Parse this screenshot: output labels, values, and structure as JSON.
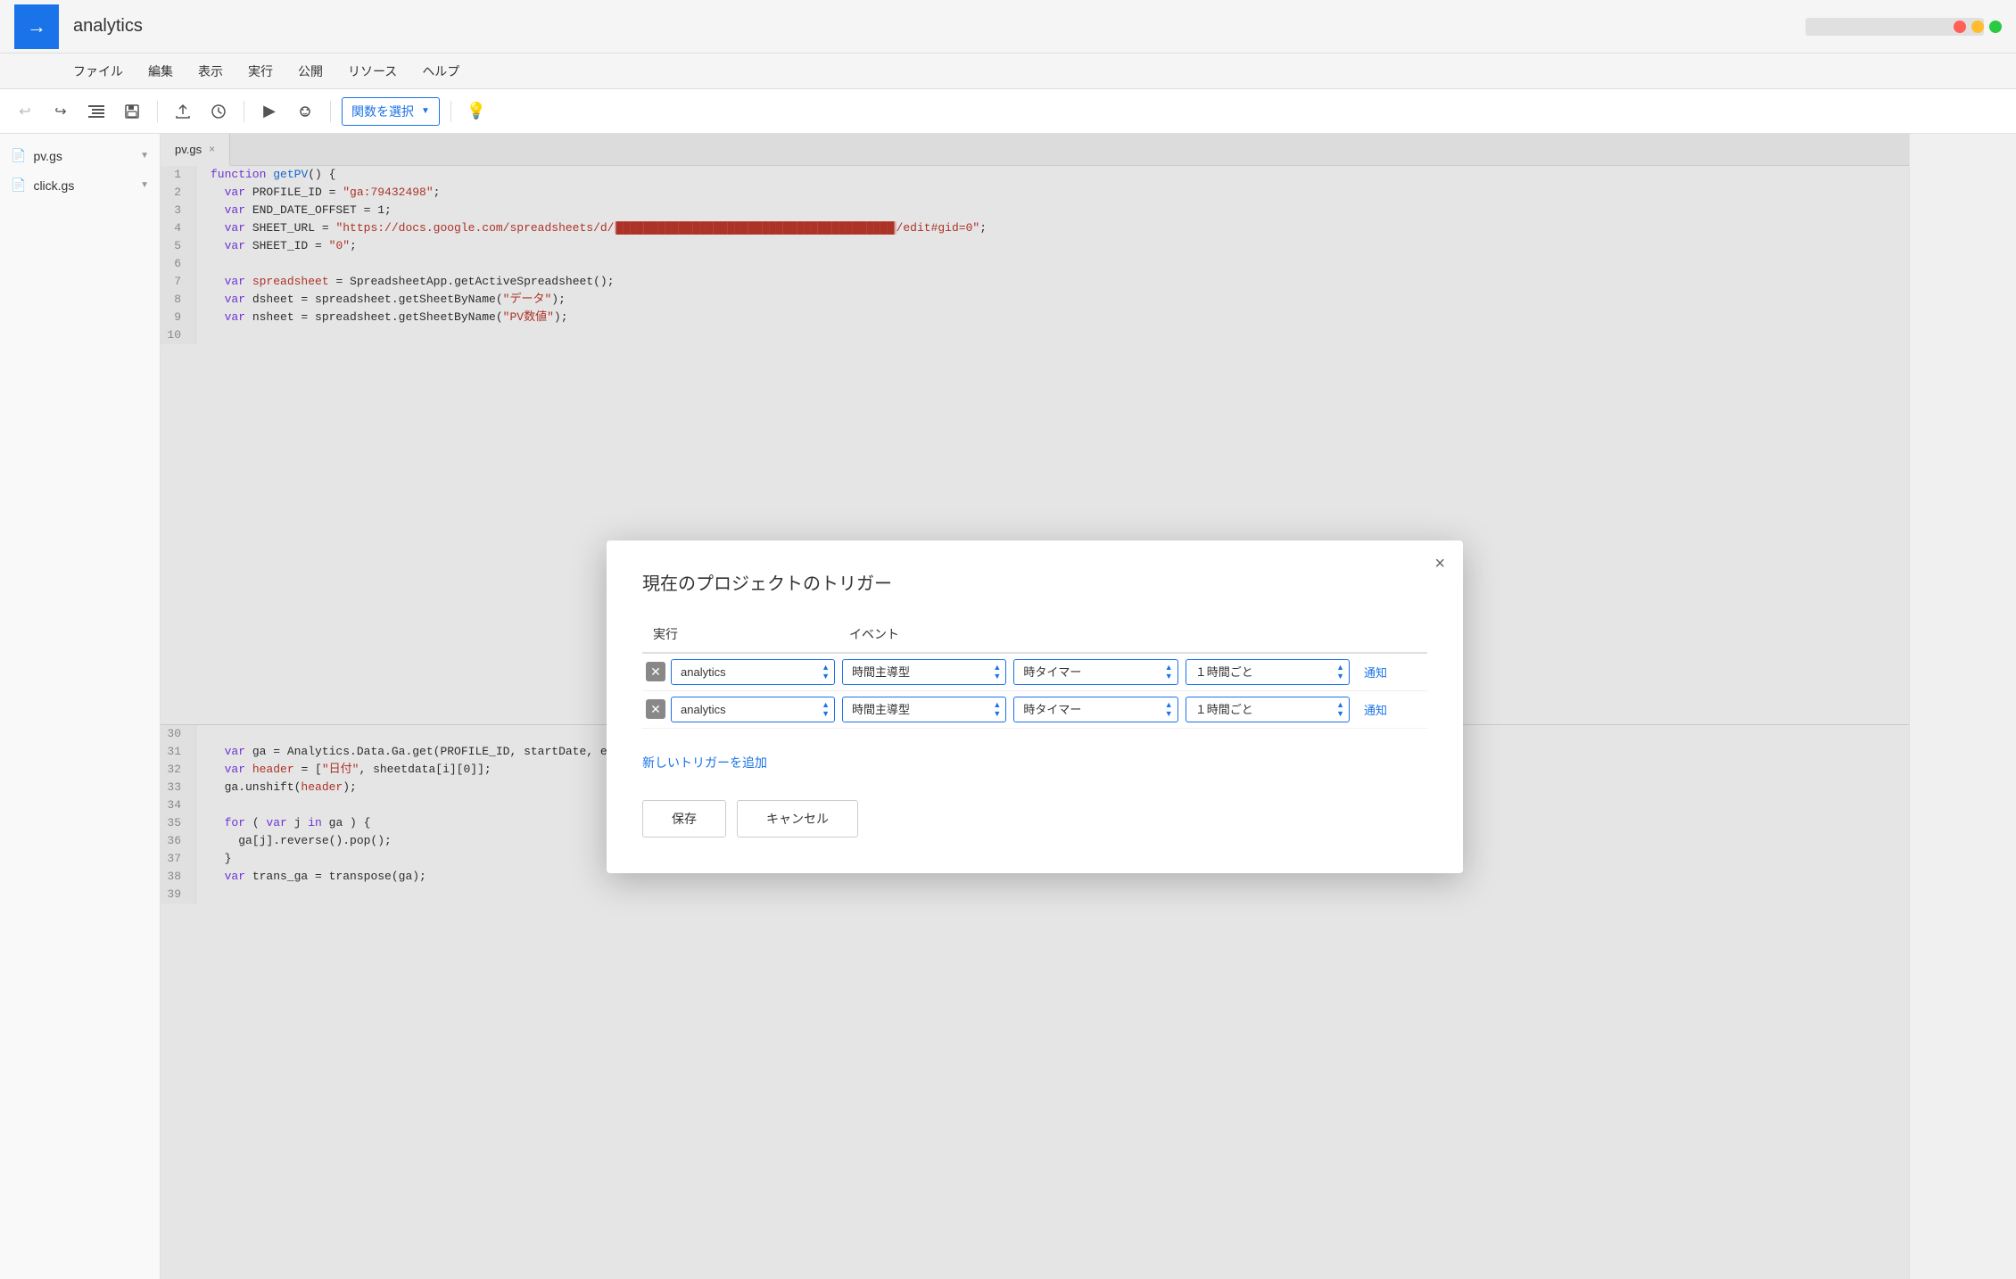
{
  "app": {
    "title": "analytics",
    "logo_char": "→"
  },
  "window_controls": {
    "close": "×",
    "minimize": "−",
    "maximize": "+"
  },
  "menu": {
    "items": [
      "ファイル",
      "編集",
      "表示",
      "実行",
      "公開",
      "リソース",
      "ヘルプ"
    ]
  },
  "toolbar": {
    "undo_label": "↩",
    "redo_label": "↪",
    "indent_label": "⇥",
    "save_label": "💾",
    "upload_label": "⬆",
    "history_label": "🕐",
    "run_label": "▶",
    "debug_label": "🐞",
    "function_select_label": "関数を選択",
    "bulb_label": "💡"
  },
  "sidebar": {
    "files": [
      {
        "name": "pv.gs",
        "active": true
      },
      {
        "name": "click.gs",
        "active": false
      }
    ]
  },
  "editor": {
    "active_tab": "pv.gs",
    "lines_top": [
      {
        "num": 1,
        "code": "function getPV() {"
      },
      {
        "num": 2,
        "code": "  var PROFILE_ID = \"ga:79432498\";"
      },
      {
        "num": 3,
        "code": "  var END_DATE_OFFSET = 1;"
      },
      {
        "num": 4,
        "code": "  var SHEET_URL = \"https://docs.google.com/spreadsheets/d/██████████████████/edit#gid=0\";"
      },
      {
        "num": 5,
        "code": "  var SHEET_ID = \"0\";"
      },
      {
        "num": 6,
        "code": ""
      },
      {
        "num": 7,
        "code": "  var spreadsheet = SpreadsheetApp.getActiveSpreadsheet();"
      },
      {
        "num": 8,
        "code": "  var dsheet = spreadsheet.getSheetByName(\"データ\");"
      },
      {
        "num": 9,
        "code": "  var nsheet = spreadsheet.getSheetByName(\"PV数値\");"
      },
      {
        "num": 10,
        "code": ""
      }
    ],
    "lines_bottom": [
      {
        "num": 30,
        "code": ""
      },
      {
        "num": 31,
        "code": "  var ga = Analytics.Data.Ga.get(PROFILE_ID, startDate, endDate, metrics, optArgs).rows;"
      },
      {
        "num": 32,
        "code": "  var header = [\"日付\", sheetdata[i][0]];"
      },
      {
        "num": 33,
        "code": "  ga.unshift(header);"
      },
      {
        "num": 34,
        "code": ""
      },
      {
        "num": 35,
        "code": "  for ( var j in ga ) {"
      },
      {
        "num": 36,
        "code": "    ga[j].reverse().pop();"
      },
      {
        "num": 37,
        "code": "  }"
      },
      {
        "num": 38,
        "code": "  var trans_ga = transpose(ga);"
      },
      {
        "num": 39,
        "code": ""
      }
    ]
  },
  "dialog": {
    "title": "現在のプロジェクトのトリガー",
    "close_char": "×",
    "table": {
      "headers": [
        "実行",
        "イベント"
      ],
      "col_jikko": "実行",
      "col_event": "イベント",
      "rows": [
        {
          "function_value": "analytics",
          "event_type": "時間主導型",
          "timer_type": "時タイマー",
          "interval": "１時間ごと",
          "notify_label": "通知"
        },
        {
          "function_value": "analytics",
          "event_type": "時間主導型",
          "timer_type": "時タイマー",
          "interval": "１時間ごと",
          "notify_label": "通知"
        }
      ]
    },
    "add_trigger_label": "新しいトリガーを追加",
    "save_label": "保存",
    "cancel_label": "キャンセル"
  }
}
